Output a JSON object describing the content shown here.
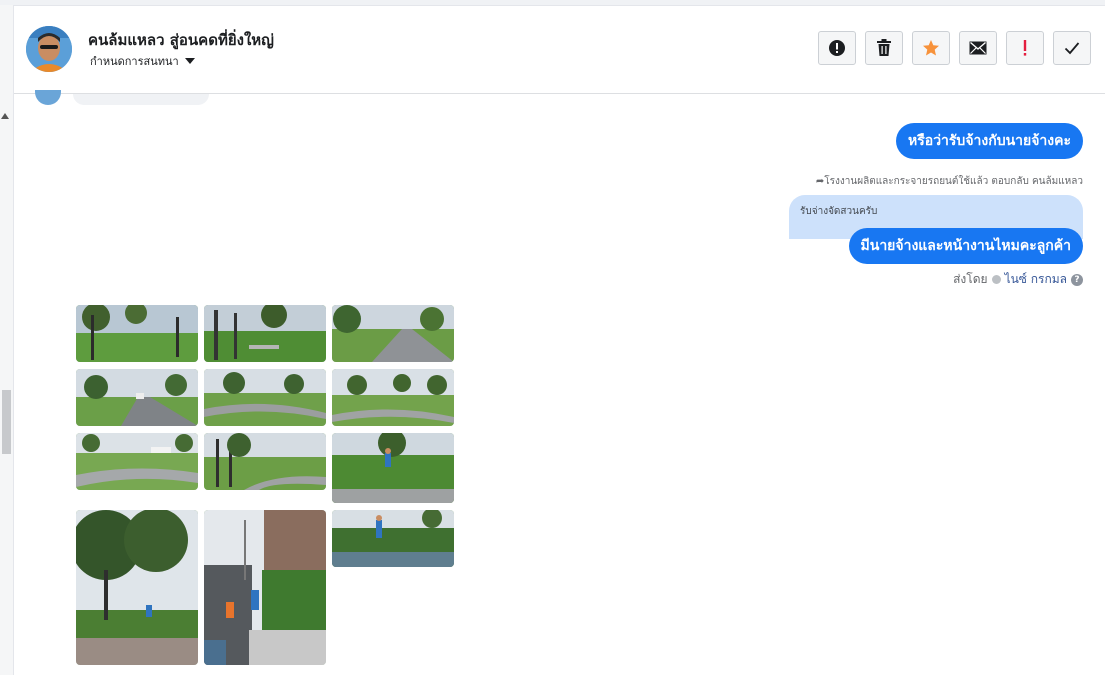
{
  "header": {
    "title": "คนล้มแหลว สู่อนคดที่ยิ่งใหญ่",
    "subtitle": "กำหนดการสนทนา",
    "tools": [
      {
        "icon": "alert-circle-icon",
        "color": "#1c1e21"
      },
      {
        "icon": "trash-icon",
        "color": "#1c1e21"
      },
      {
        "icon": "star-icon",
        "color": "#f7923b"
      },
      {
        "icon": "envelope-icon",
        "color": "#1c1e21"
      },
      {
        "icon": "exclamation-icon",
        "color": "#e41e3f"
      },
      {
        "icon": "checkmark-icon",
        "color": "#1c1e21"
      }
    ]
  },
  "messages": {
    "msg1": "หรือว่ารับจ้างกับนายจ้างคะ",
    "reply_meta": "โรงงานผลิตและกระจายรถยนต์ใช้แล้ว ตอบกลับ คนล้มแหลว",
    "quoted": "รับจ่างจัดสวนครับ",
    "msg2": "มีนายจ้างและหน้างานไหมคะลูกค้า",
    "sent_by_label": "ส่งโดย",
    "sent_by_name": "ไนซ์ กรกมล",
    "help_glyph": "?"
  },
  "colors": {
    "accent": "#1877f2",
    "quoted_bg": "#cde1fb",
    "divider": "#dddfe2"
  },
  "photos": {
    "count": 12,
    "scenes": [
      "lawn-trees",
      "lawn-trees",
      "road-lawn",
      "road-lawn",
      "lawn-path",
      "lawn-path",
      "lawn-path",
      "lawn-trees",
      "worker-hedge",
      "trees-worker",
      "building-worker",
      "worker-water"
    ]
  }
}
